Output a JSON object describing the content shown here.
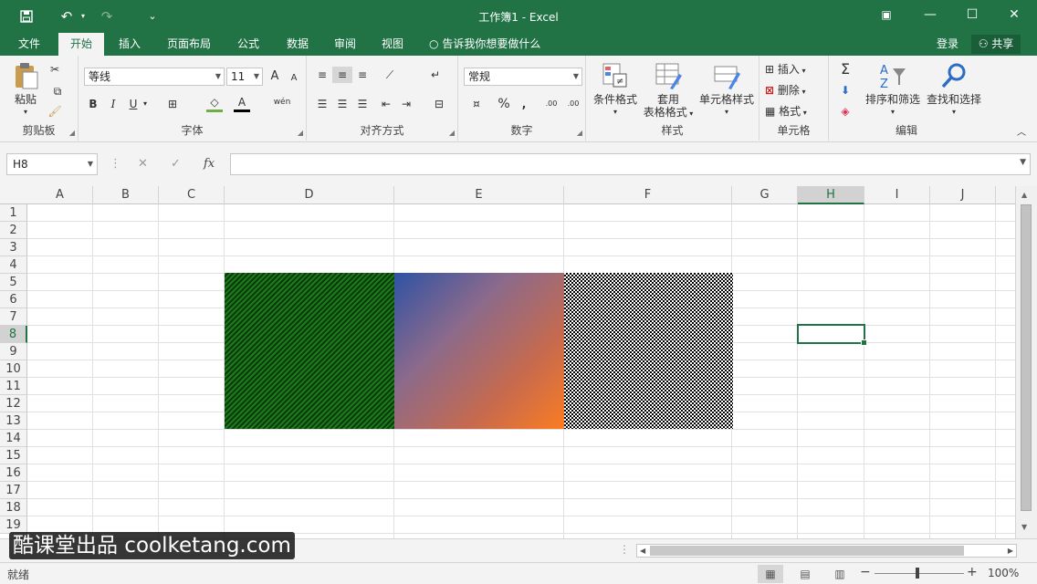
{
  "titlebar": {
    "save_icon": "save-icon",
    "title": "工作簿1 - Excel",
    "undo": "↶",
    "redo": "↷",
    "customize": "⌄",
    "ribbon_options": "▣",
    "minimize": "—",
    "maximize": "☐",
    "close": "✕"
  },
  "tabs": {
    "file": "文件",
    "home": "开始",
    "insert": "插入",
    "page_layout": "页面布局",
    "formulas": "公式",
    "data": "数据",
    "review": "审阅",
    "view": "视图",
    "tell_me": "告诉我你想要做什么",
    "login": "登录",
    "share": "共享"
  },
  "ribbon": {
    "clipboard": {
      "paste": "粘贴",
      "label": "剪贴板"
    },
    "font": {
      "name": "等线",
      "size": "11",
      "bold": "B",
      "italic": "I",
      "underline": "U",
      "grow": "A",
      "shrink": "A",
      "phonetic": "wén",
      "label": "字体"
    },
    "alignment": {
      "label": "对齐方式"
    },
    "number": {
      "format": "常规",
      "percent": "%",
      "comma": ",",
      "inc_decimal": ".00",
      "dec_decimal": ".00",
      "label": "数字"
    },
    "styles": {
      "conditional": "条件格式",
      "table_line1": "套用",
      "table_line2": "表格格式",
      "cell_styles": "单元格样式",
      "label": "样式"
    },
    "cells": {
      "insert": "插入",
      "delete": "删除",
      "format": "格式",
      "label": "单元格"
    },
    "editing": {
      "sort": "排序和筛选",
      "find": "查找和选择",
      "label": "编辑"
    }
  },
  "formula_bar": {
    "name_box": "H8",
    "cancel": "✕",
    "enter": "✓",
    "fx": "fx",
    "formula": ""
  },
  "columns": [
    "A",
    "B",
    "C",
    "D",
    "E",
    "F",
    "G",
    "H",
    "I",
    "J"
  ],
  "selected_column": "H",
  "rows": [
    "1",
    "2",
    "3",
    "4",
    "5",
    "6",
    "7",
    "8",
    "9",
    "10",
    "11",
    "12",
    "13",
    "14",
    "15",
    "16",
    "17",
    "18",
    "19"
  ],
  "selected_row": "8",
  "watermark": "酷课堂出品 coolketang.com",
  "status": {
    "ready": "就绪",
    "zoom": "100%",
    "zoom_minus": "−",
    "zoom_plus": "+"
  },
  "colors": {
    "accent": "#217346",
    "green_pattern": "#1d7a1d",
    "gradient_start": "#2f52a4",
    "gradient_end": "#fb7c22"
  }
}
